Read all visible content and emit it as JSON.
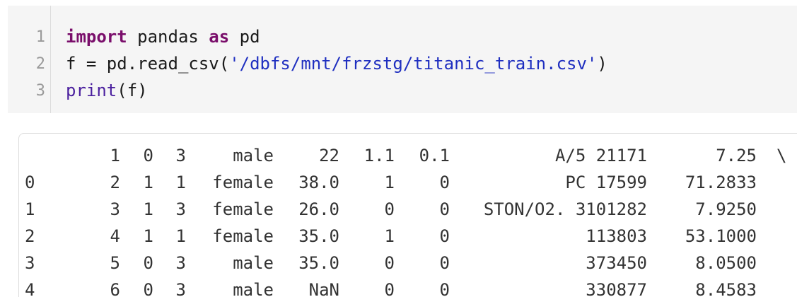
{
  "code": {
    "line_numbers": [
      "1",
      "2",
      "3"
    ],
    "line1": {
      "kw_import": "import",
      "module": " pandas ",
      "kw_as": "as",
      "alias": " pd"
    },
    "line2": {
      "prefix": "f = pd.read_csv(",
      "path": "'/dbfs/mnt/frzstg/titanic_train.csv'",
      "suffix": ")"
    },
    "line3": {
      "fn": "print",
      "args": "(f)"
    }
  },
  "output": {
    "header": [
      "",
      "1",
      "0",
      "3",
      "male",
      "22",
      "1.1",
      "0.1",
      "A/5 21171",
      "7.25",
      "\\"
    ],
    "rows": [
      [
        "0",
        "2",
        "1",
        "1",
        "female",
        "38.0",
        "1",
        "0",
        "PC 17599",
        "71.2833"
      ],
      [
        "1",
        "3",
        "1",
        "3",
        "female",
        "26.0",
        "0",
        "0",
        "STON/O2. 3101282",
        "7.9250"
      ],
      [
        "2",
        "4",
        "1",
        "1",
        "female",
        "35.0",
        "1",
        "0",
        "113803",
        "53.1000"
      ],
      [
        "3",
        "5",
        "0",
        "3",
        "male",
        "35.0",
        "0",
        "0",
        "373450",
        "8.0500"
      ],
      [
        "4",
        "6",
        "0",
        "3",
        "male",
        "NaN",
        "0",
        "0",
        "330877",
        "8.4583"
      ]
    ]
  }
}
